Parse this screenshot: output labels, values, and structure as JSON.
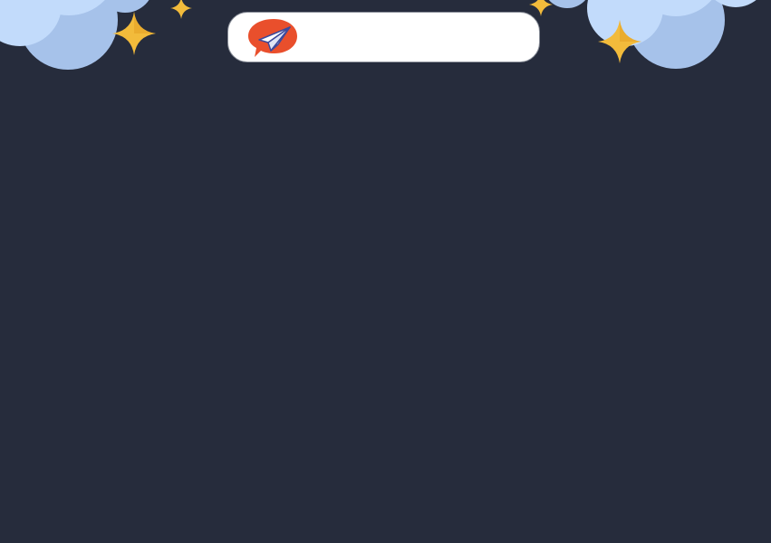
{
  "theme": {
    "background": "#262c3c",
    "cloud_light": "#c2dbfb",
    "cloud_dark": "#a6c2ea",
    "star": "#f2bb3b",
    "star_shade": "#e29e22",
    "logo_bubble": "#e94f2c",
    "logo_plane": "#ffffff",
    "logo_plane_shade": "#3c4a9c"
  },
  "header": {
    "search": {
      "value": "",
      "placeholder": ""
    },
    "logo": {
      "icon": "paper-plane-icon"
    }
  }
}
